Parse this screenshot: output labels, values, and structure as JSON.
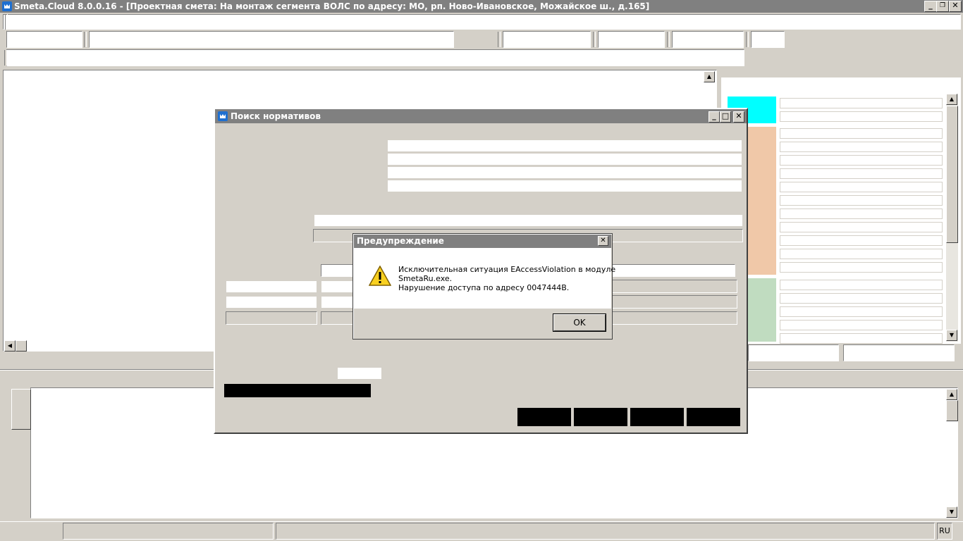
{
  "window": {
    "title": "Smeta.Cloud  8.0.0.16  - [Проектная смета: На монтаж сегмента ВОЛС по адресу: МО, рп. Ново-Ивановское, Можайское ш., д.165]",
    "minimize": "_",
    "restore": "❐",
    "close": "✕"
  },
  "search_dialog": {
    "title": "Поиск нормативов",
    "minimize": "_",
    "maximize": "□",
    "close": "✕"
  },
  "warning": {
    "title": "Предупреждение",
    "close": "✕",
    "line1": "Исключительная ситуация EAccessViolation в модуле",
    "line2": "SmetaRu.exe.",
    "line3": "Нарушение доступа по адресу 0047444B.",
    "ok": "OK",
    "icon": "warning-icon"
  },
  "statusbar": {
    "lang": "RU"
  },
  "colors": {
    "cyan": "#00ffff",
    "peach": "#f0c8a8",
    "mint": "#c0dcc0"
  }
}
